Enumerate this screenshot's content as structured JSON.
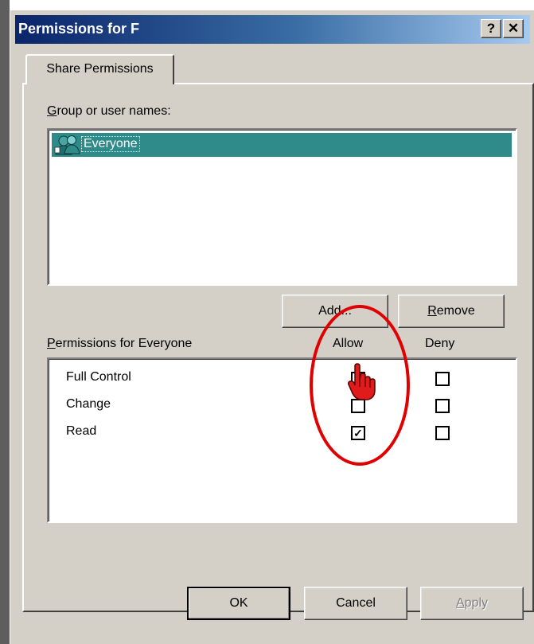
{
  "window": {
    "title": "Permissions for F",
    "help_label": "?",
    "close_label": "✕"
  },
  "tabs": [
    {
      "label": "Share Permissions",
      "active": true
    }
  ],
  "groups": {
    "label": "Group or user names:",
    "items": [
      {
        "name": "Everyone",
        "icon": "users-group-icon",
        "selected": true
      }
    ]
  },
  "buttons": {
    "add": "Add...",
    "remove": "Remove",
    "ok": "OK",
    "cancel": "Cancel",
    "apply": "Apply"
  },
  "permissions": {
    "label": "Permissions for Everyone",
    "allow_header": "Allow",
    "deny_header": "Deny",
    "rows": [
      {
        "name": "Full Control",
        "allow": false,
        "deny": false
      },
      {
        "name": "Change",
        "allow": false,
        "deny": false
      },
      {
        "name": "Read",
        "allow": true,
        "deny": false
      }
    ]
  },
  "colors": {
    "title_start": "#0a246a",
    "title_end": "#a6caf0",
    "selection": "#2f8a8a",
    "annotation": "#e00000",
    "face": "#d4d0c8"
  }
}
